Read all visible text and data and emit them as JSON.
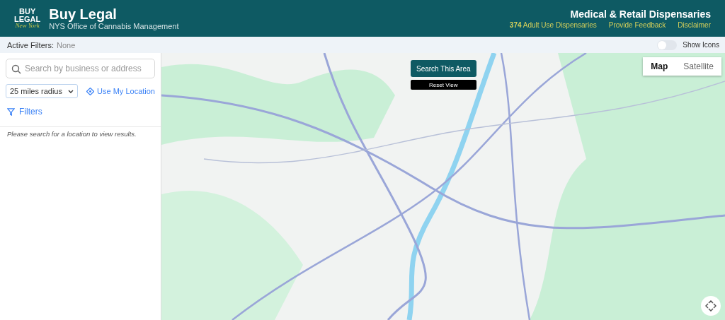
{
  "header": {
    "logo": {
      "line_1": "BUY",
      "line_2": "LEGAL",
      "line_3": "New York"
    },
    "title": "Buy Legal",
    "subtitle": "NYS Office of Cannabis Management",
    "right_title": "Medical & Retail Dispensaries",
    "links": [
      {
        "label": "**374** Adult Use Dispensaries"
      },
      {
        "label": "Provide Feedback"
      },
      {
        "label": "Disclaimer"
      }
    ]
  },
  "filter_bar": {
    "label": "Active Filters:",
    "value": "None",
    "toggle": {
      "label": "Show Icons",
      "on": false
    }
  },
  "sidebar": {
    "search": {
      "placeholder": "Search by business or address"
    },
    "radius": {
      "value": "25 miles radius"
    },
    "use_location": "Use My Location",
    "filters": "Filters",
    "empty_message": "Please search for a location to view results."
  },
  "map": {
    "search_area": "Search This Area",
    "reset_view": "Reset View",
    "map_types": [
      {
        "label": "Map",
        "selected": true
      },
      {
        "label": "Satellite",
        "selected": false
      }
    ]
  }
}
